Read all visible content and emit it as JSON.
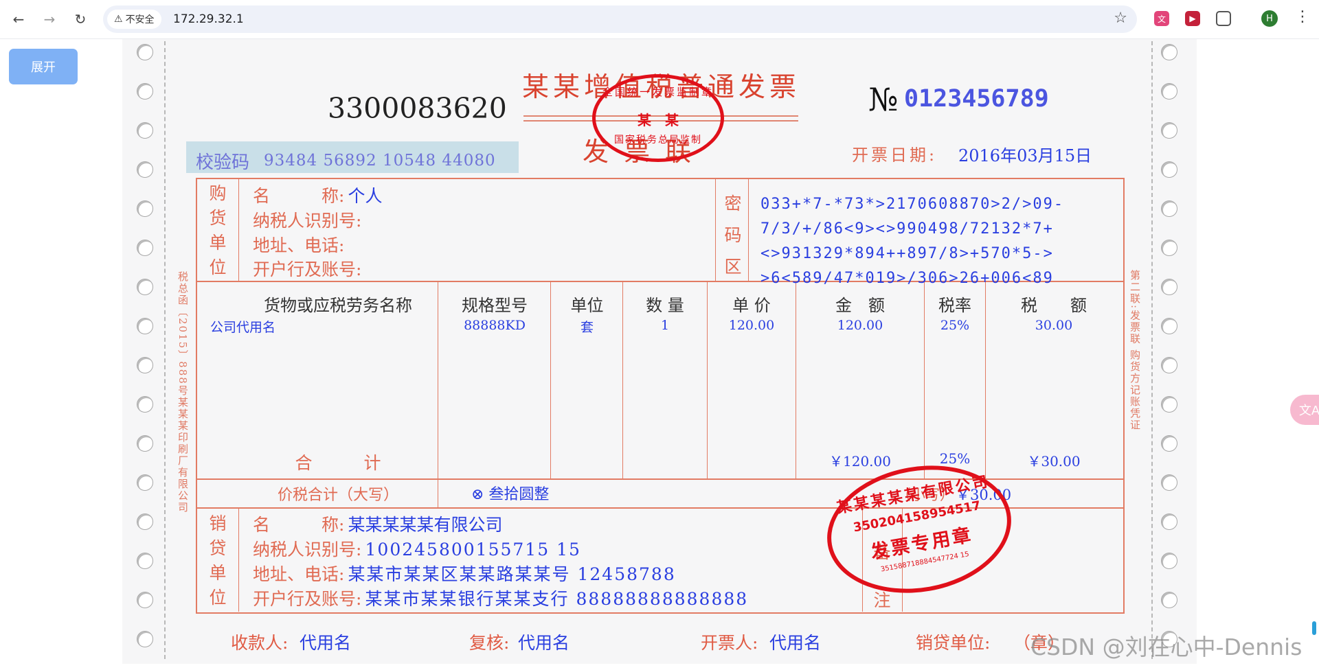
{
  "browser": {
    "security_label": "不安全",
    "url": "172.29.32.1",
    "avatar_letter": "H"
  },
  "page": {
    "expand_button": "展开"
  },
  "invoice": {
    "title": "某某增值税普通发票",
    "subtitle": "发票联",
    "code": "3300083620",
    "number_symbol": "№",
    "number": "0123456789",
    "check_label": "校验码",
    "check_code": "93484 56892 10548 44080",
    "date_label": "开票日期:",
    "date_value": "2016年03月15日",
    "left_margin_text": "税总函〔2015〕888号某某某印刷厂有限公司",
    "right_margin_text": "第二联:发票联 购货方记账凭证",
    "buyer": {
      "section_label": [
        "购",
        "货",
        "单",
        "位"
      ],
      "name_label": "名　　　称:",
      "name": "个人",
      "tax_id_label": "纳税人识别号:",
      "address_label": "地址、电话:",
      "bank_label": "开户行及账号:"
    },
    "cipher": {
      "section_label": [
        "密",
        "码",
        "区"
      ],
      "lines": [
        "033+*7-*73*>2170608870>2/>09-",
        "7/3/+/86<9><>990498/72132*7+",
        "<>931329*894++897/8>+570*5->",
        ">6<589/47*019>/306>26+006<89"
      ]
    },
    "headers": {
      "item": "货物或应税劳务名称",
      "spec": "规格型号",
      "unit": "单位",
      "qty": "数 量",
      "price": "单 价",
      "amount": "金　额",
      "rate": "税率",
      "tax": "税　　额"
    },
    "line_item": {
      "name": "公司代用名",
      "spec": "88888KD",
      "unit": "套",
      "qty": "1",
      "price": "120.00",
      "amount": "120.00",
      "rate": "25%",
      "tax": "30.00"
    },
    "total": {
      "label": "合　　　计",
      "amount": "￥120.00",
      "rate": "25%",
      "tax": "￥30.00"
    },
    "grand_total": {
      "label": "价税合计（大写）",
      "in_words": "⊗ 叁拾圆整",
      "small_label": "（小写）",
      "small_value": "￥30.00"
    },
    "seller": {
      "section_label": [
        "销",
        "贷",
        "单",
        "位"
      ],
      "name_label": "名　　　称:",
      "name": "某某某某某有限公司",
      "tax_id_label": "纳税人识别号:",
      "tax_id": "100245800155715 15",
      "address_label": "地址、电话:",
      "address": "某某市某某区某某路某某号 12458788",
      "bank_label": "开户行及账号:",
      "bank": "某某市某某银行某某支行 88888888888888"
    },
    "remark_label": [
      "备",
      "注"
    ],
    "footer": {
      "payee_label": "收款人:",
      "payee": "代用名",
      "reviewer_label": "复核:",
      "reviewer": "代用名",
      "issuer_label": "开票人:",
      "issuer": "代用名",
      "seller_label": "销贷单位:",
      "seal_label": "（章）"
    },
    "stamp_top": {
      "ring_text": "全国统一发票监制章",
      "center": "某　某",
      "bottom": "国家税务总局监制"
    },
    "stamp_seller": {
      "ring_text": "某某某某某有限公司",
      "tax_no": "350204158954517",
      "center": "发票专用章",
      "bottom": "351588718884547724 15"
    }
  },
  "watermark": "CSDN @刘在心中-Dennis"
}
